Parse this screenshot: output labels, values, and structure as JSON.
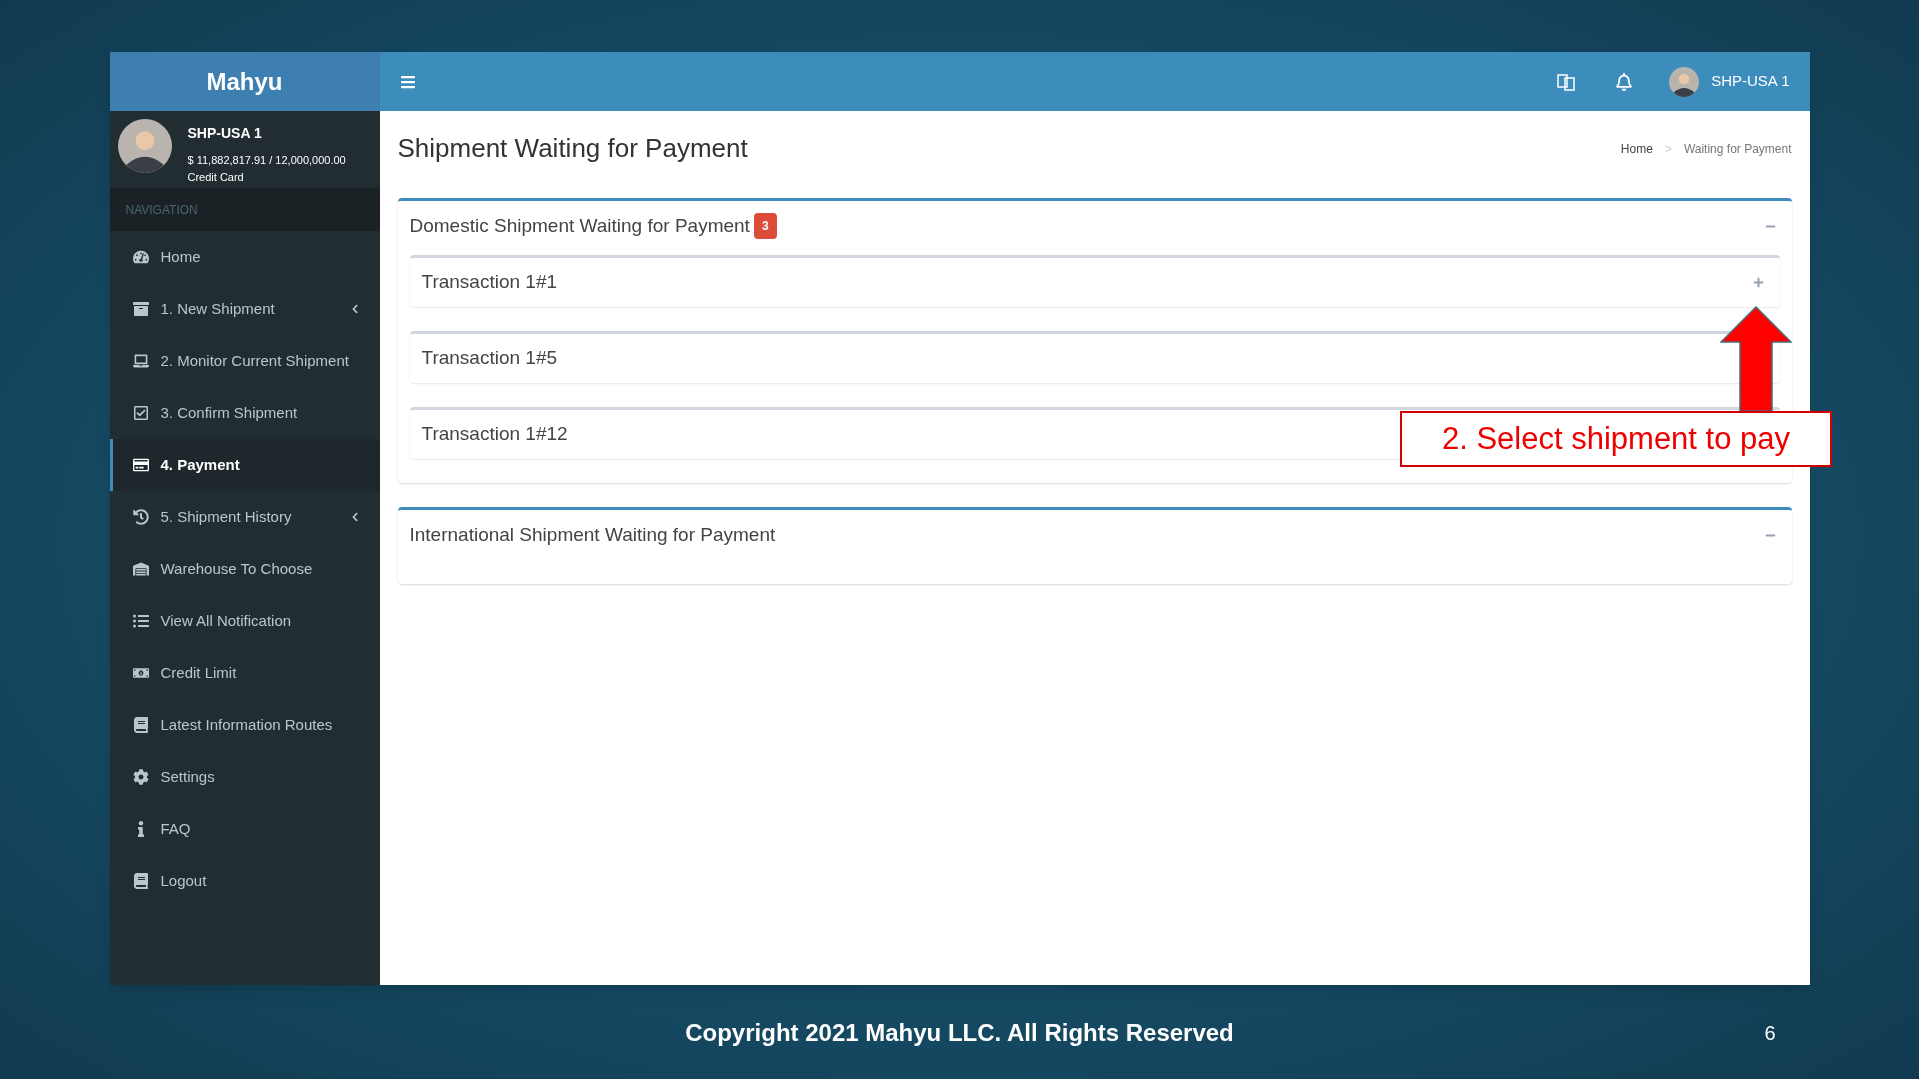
{
  "brand": "Mahyu",
  "user": {
    "name": "SHP-USA 1",
    "balance": "$ 11,882,817.91 / 12,000,000.00",
    "payment_method": "Credit Card"
  },
  "topbar": {
    "user_name": "SHP-USA 1"
  },
  "sidebar": {
    "heading": "NAVIGATION",
    "items": [
      {
        "label": "Home",
        "selected": false,
        "has_submenu": false
      },
      {
        "label": "1. New Shipment",
        "selected": false,
        "has_submenu": true
      },
      {
        "label": "2. Monitor Current Shipment",
        "selected": false,
        "has_submenu": false
      },
      {
        "label": "3. Confirm Shipment",
        "selected": false,
        "has_submenu": false
      },
      {
        "label": "4. Payment",
        "selected": true,
        "has_submenu": false
      },
      {
        "label": "5. Shipment History",
        "selected": false,
        "has_submenu": true
      },
      {
        "label": "Warehouse To Choose",
        "selected": false,
        "has_submenu": false
      },
      {
        "label": "View All Notification",
        "selected": false,
        "has_submenu": false
      },
      {
        "label": "Credit Limit",
        "selected": false,
        "has_submenu": false
      },
      {
        "label": "Latest Information Routes",
        "selected": false,
        "has_submenu": false
      },
      {
        "label": "Settings",
        "selected": false,
        "has_submenu": false
      },
      {
        "label": "FAQ",
        "selected": false,
        "has_submenu": false
      },
      {
        "label": "Logout",
        "selected": false,
        "has_submenu": false
      }
    ]
  },
  "page": {
    "title": "Shipment Waiting for Payment",
    "breadcrumb": [
      "Home",
      "Waiting for Payment"
    ],
    "breadcrumb_separator": ">"
  },
  "panels": [
    {
      "title": "Domestic Shipment Waiting for Payment",
      "badge": "3",
      "expanded": true,
      "transactions": [
        {
          "label": "Transaction 1#1",
          "toggle_visible": true
        },
        {
          "label": "Transaction 1#5",
          "toggle_visible": false
        },
        {
          "label": "Transaction 1#12",
          "toggle_visible": false
        }
      ]
    },
    {
      "title": "International Shipment Waiting for Payment",
      "expanded": true
    }
  ],
  "callout": {
    "text": "2. Select shipment to pay"
  },
  "footer": {
    "copyright": "Copyright 2021 Mahyu LLC. All Rights Reserved",
    "page_number": "6"
  }
}
